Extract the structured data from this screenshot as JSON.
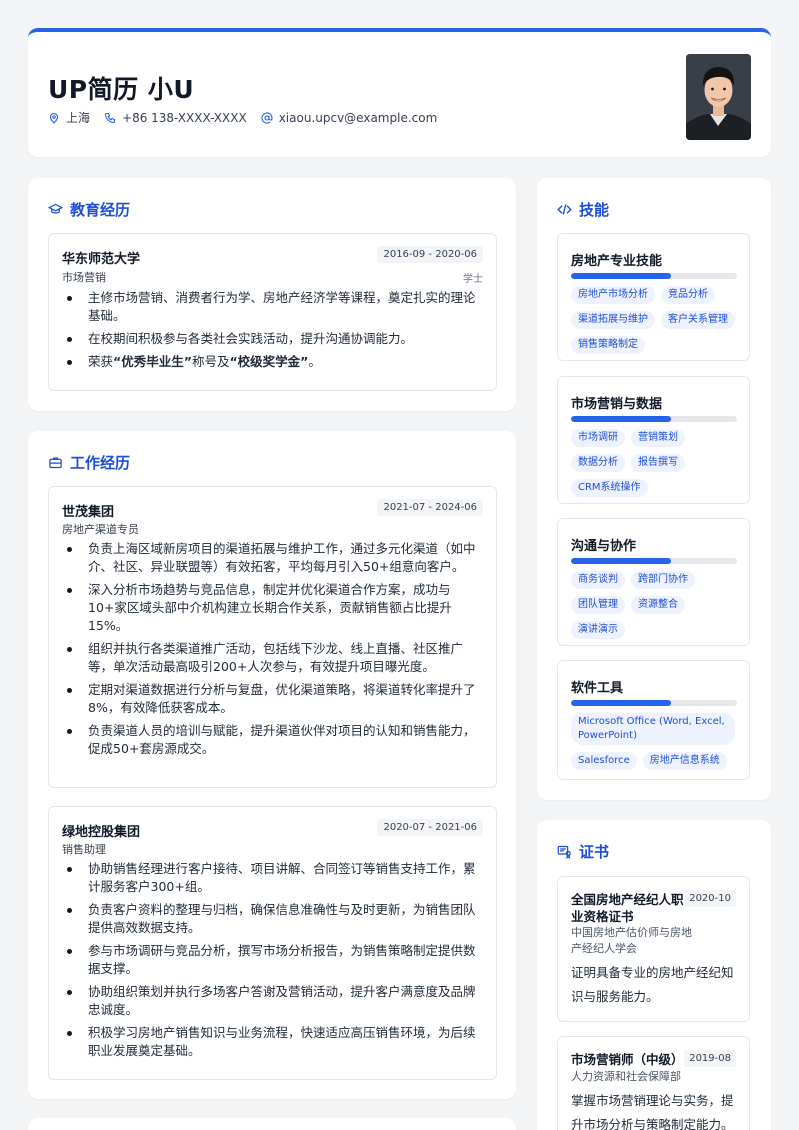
{
  "header": {
    "name": "UP简历 小U",
    "location": "上海",
    "phone": "+86 138-XXXX-XXXX",
    "email": "xiaou.upcv@example.com"
  },
  "education": {
    "title": "教育经历",
    "entries": [
      {
        "org": "华东师范大学",
        "date": "2016-09 - 2020-06",
        "role": "市场营销",
        "degree": "学士",
        "bullets": [
          "主修市场营销、消费者行为学、房地产经济学等课程，奠定扎实的理论基础。",
          "在校期间积极参与各类社会实践活动，提升沟通协调能力。"
        ],
        "honor": {
          "p1": "荣获",
          "b1": "“优秀毕业生”",
          "p2": "称号及",
          "b2": "“校级奖学金”",
          "p3": "。"
        }
      }
    ]
  },
  "work": {
    "title": "工作经历",
    "entries": [
      {
        "org": "世茂集团",
        "date": "2021-07 - 2024-06",
        "role": "房地产渠道专员",
        "bullets": [
          "负责上海区域新房项目的渠道拓展与维护工作，通过多元化渠道（如中介、社区、异业联盟等）有效拓客，平均每月引入50+组意向客户。",
          "深入分析市场趋势与竞品信息，制定并优化渠道合作方案，成功与10+家区域头部中介机构建立长期合作关系，贡献销售额占比提升15%。",
          "组织并执行各类渠道推广活动，包括线下沙龙、线上直播、社区推广等，单次活动最高吸引200+人次参与，有效提升项目曝光度。",
          "定期对渠道数据进行分析与复盘，优化渠道策略，将渠道转化率提升了8%，有效降低获客成本。",
          "负责渠道人员的培训与赋能，提升渠道伙伴对项目的认知和销售能力，促成50+套房源成交。"
        ]
      },
      {
        "org": "绿地控股集团",
        "date": "2020-07 - 2021-06",
        "role": "销售助理",
        "bullets": [
          "协助销售经理进行客户接待、项目讲解、合同签订等销售支持工作，累计服务客户300+组。",
          "负责客户资料的整理与归档，确保信息准确性与及时更新，为销售团队提供高效数据支持。",
          "参与市场调研与竞品分析，撰写市场分析报告，为销售策略制定提供数据支撑。",
          "协助组织策划并执行多场客户答谢及营销活动，提升客户满意度及品牌忠诚度。",
          "积极学习房地产销售知识与业务流程，快速适应高压销售环境，为后续职业发展奠定基础。"
        ]
      }
    ]
  },
  "skills": {
    "title": "技能",
    "groups": [
      {
        "name": "房地产专业技能",
        "level": 0.6,
        "tags": [
          "房地产市场分析",
          "竞品分析",
          "渠道拓展与维护",
          "客户关系管理",
          "销售策略制定"
        ]
      },
      {
        "name": "市场营销与数据",
        "level": 0.6,
        "tags": [
          "市场调研",
          "营销策划",
          "数据分析",
          "报告撰写",
          "CRM系统操作"
        ]
      },
      {
        "name": "沟通与协作",
        "level": 0.6,
        "tags": [
          "商务谈判",
          "跨部门协作",
          "团队管理",
          "资源整合",
          "演讲演示"
        ]
      },
      {
        "name": "软件工具",
        "level": 0.6,
        "tags": [
          "Microsoft Office (Word, Excel, PowerPoint)",
          "Salesforce",
          "房地产信息系统"
        ]
      }
    ]
  },
  "certificates": {
    "title": "证书",
    "items": [
      {
        "name": "全国房地产经纪人职业资格证书",
        "date": "2020-10",
        "issuer": "中国房地产估价师与房地产经纪人学会",
        "desc": "证明具备专业的房地产经纪知识与服务能力。"
      },
      {
        "name": "市场营销师（中级）",
        "date": "2019-08",
        "issuer": "人力资源和社会保障部",
        "desc": "掌握市场营销理论与实务，提升市场分析与策略制定能力。"
      }
    ]
  },
  "colors": {
    "accent": "#2563eb",
    "tag_bg": "#eef2ff"
  }
}
